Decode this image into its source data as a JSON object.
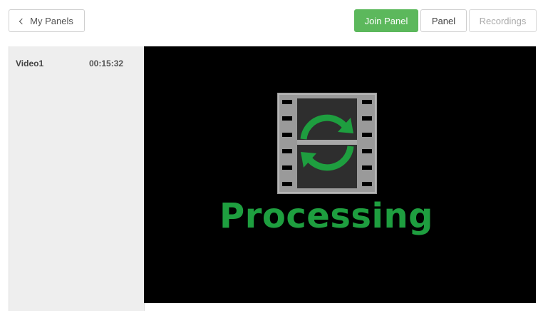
{
  "header": {
    "back_label": "My Panels",
    "join_label": "Join Panel",
    "panel_label": "Panel",
    "recordings_label": "Recordings"
  },
  "recordings": [
    {
      "name": "Video1",
      "duration": "00:15:32"
    }
  ],
  "player": {
    "status_text": "Processing",
    "status_icon": "processing-film-icon"
  },
  "colors": {
    "accent": "#5cb85c",
    "processing_green": "#1e9e3f"
  }
}
